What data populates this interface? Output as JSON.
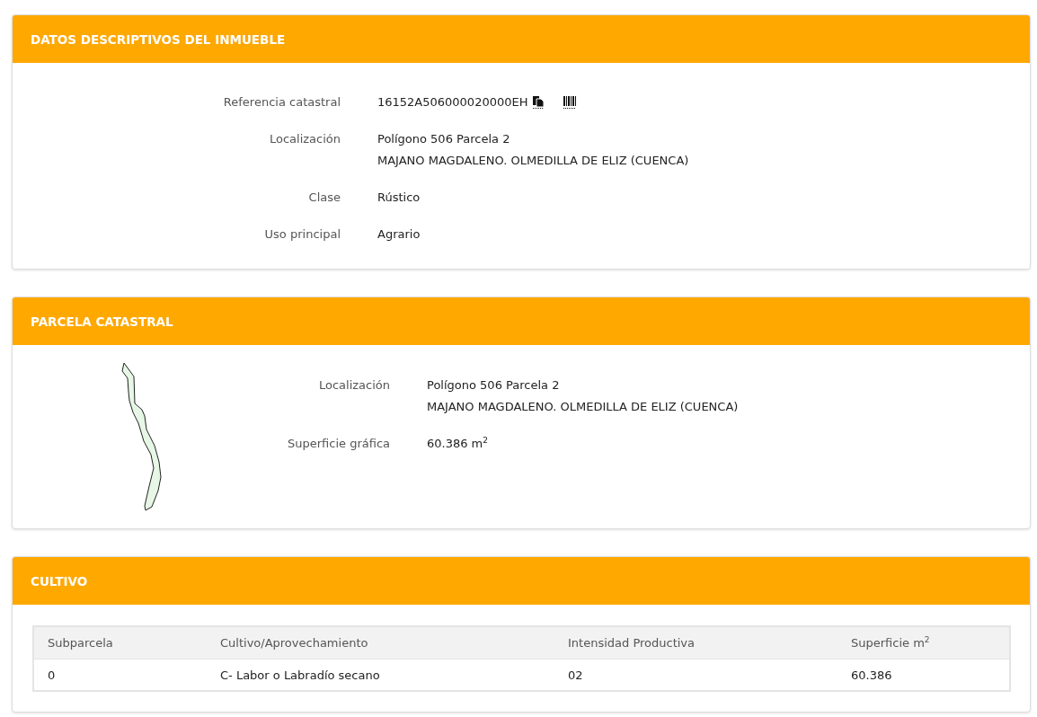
{
  "inmueble": {
    "title": "DATOS DESCRIPTIVOS DEL INMUEBLE",
    "fields": [
      {
        "kind": "reference",
        "label": "Referencia catastral",
        "lines": [
          "16152A506000020000EH"
        ]
      },
      {
        "kind": "text",
        "label": "Localización",
        "lines": [
          "Polígono 506 Parcela 2",
          "MAJANO MAGDALENO. OLMEDILLA DE ELIZ (CUENCA)"
        ]
      },
      {
        "kind": "text",
        "label": "Clase",
        "lines": [
          "Rústico"
        ]
      },
      {
        "kind": "text",
        "label": "Uso principal",
        "lines": [
          "Agrario"
        ]
      }
    ]
  },
  "parcela": {
    "title": "PARCELA CATASTRAL",
    "fields": [
      {
        "kind": "text",
        "label": "Localización",
        "lines": [
          "Polígono 506 Parcela 2",
          "MAJANO MAGDALENO. OLMEDILLA DE ELIZ (CUENCA)"
        ]
      },
      {
        "kind": "text",
        "label": "Superficie gráfica",
        "lines": [
          "60.386 m$^{2}$"
        ]
      }
    ]
  },
  "cultivo": {
    "title": "CULTIVO",
    "table": {
      "columns": [
        "Subparcela",
        "Cultivo/Aprovechamiento",
        "Intensidad Productiva",
        "Superficie m$^{2}$"
      ],
      "rows": [
        [
          "0",
          "C- Labor o Labradío secano",
          "02",
          "60.386"
        ]
      ]
    }
  }
}
